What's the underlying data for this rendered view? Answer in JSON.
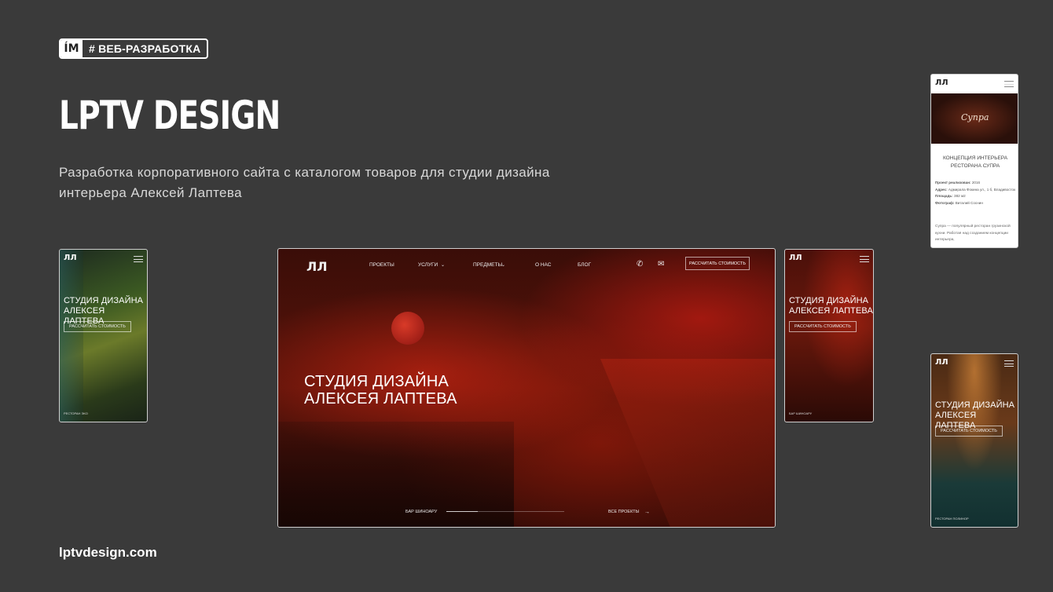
{
  "badge": {
    "logo": "ÍM",
    "tag": "# ВЕБ-РАЗРАБОТКА"
  },
  "title": "LPTV DESIGN",
  "description": "Разработка корпоративного сайта с каталогом товаров для студии дизайна интерьера Алексей Лаптева",
  "site_url": "lptvdesign.com",
  "main_screen": {
    "logo": "ЛЛ",
    "nav": [
      "ПРОЕКТЫ",
      "УСЛУГИ",
      "ПРЕДМЕТЫ",
      "О НАС",
      "БЛОГ"
    ],
    "cta": "РАССЧИТАТЬ СТОИМОСТЬ",
    "hero": [
      "СТУДИЯ ДИЗАЙНА",
      "АЛЕКСЕЯ ЛАПТЕВА"
    ],
    "caption": "БАР ШИНОАРУ",
    "all_projects": "ВСЕ ПРОЕКТЫ",
    "colors": {
      "accent": "#c8291a"
    }
  },
  "mobile_left": {
    "logo": "ЛЛ",
    "hero": [
      "СТУДИЯ ДИЗАЙНА",
      "АЛЕКСЕЯ ЛАПТЕВА"
    ],
    "button": "РАССЧИТАТЬ СТОИМОСТЬ",
    "caption": "РЕСТОРАН ЭКО"
  },
  "mobile_mid": {
    "logo": "ЛЛ",
    "hero": [
      "СТУДИЯ ДИЗАЙНА",
      "АЛЕКСЕЯ ЛАПТЕВА"
    ],
    "button": "РАССЧИТАТЬ СТОИМОСТЬ",
    "caption": "БАР ШИНОАРУ"
  },
  "mobile_top": {
    "logo": "ЛЛ",
    "photo_caption": "Супра",
    "heading": "КОНЦЕПЦИЯ ИНТЕРЬЕРА РЕСТОРАНА СУПРА",
    "details": [
      {
        "label": "Проект реализован:",
        "value": "2016"
      },
      {
        "label": "Адрес:",
        "value": "Адмирала Фокина ул., 1 б, Владивосток"
      },
      {
        "label": "Площадь:",
        "value": "382 м2"
      },
      {
        "label": "Фотограф:",
        "value": "Виталий Соснин"
      }
    ],
    "body": "Супра — популярный ресторан грузинской кухни. Работая над созданием концепции интерьера,"
  },
  "mobile_bottom": {
    "logo": "ЛЛ",
    "hero": [
      "СТУДИЯ ДИЗАЙНА",
      "АЛЕКСЕЯ ЛАПТЕВА"
    ],
    "button": "РАССЧИТАТЬ СТОИМОСТЬ",
    "caption": "РЕСТОРАН ПОЛИНОР"
  }
}
